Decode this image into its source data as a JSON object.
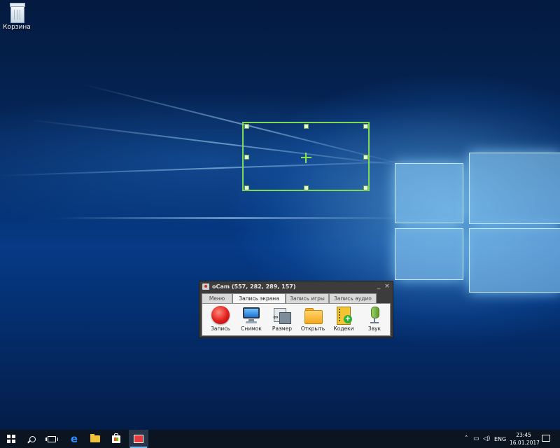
{
  "desktop": {
    "recycle_bin_label": "Корзина",
    "recycle_bin_icon": "recycle-bin-icon"
  },
  "ocam": {
    "title": "oCam (557, 282, 289, 157)",
    "minimize": "_",
    "close": "×",
    "tabs": [
      {
        "label": "Меню",
        "active": false
      },
      {
        "label": "Запись экрана",
        "active": true
      },
      {
        "label": "Запись игры",
        "active": false
      },
      {
        "label": "Запись аудио",
        "active": false
      }
    ],
    "tools": [
      {
        "label": "Запись",
        "icon": "record-icon"
      },
      {
        "label": "Снимок",
        "icon": "monitor-icon"
      },
      {
        "label": "Размер",
        "icon": "resize-icon"
      },
      {
        "label": "Открыть",
        "icon": "folder-icon"
      },
      {
        "label": "Кодеки",
        "icon": "codec-icon"
      },
      {
        "label": "Звук",
        "icon": "microphone-icon"
      }
    ]
  },
  "taskbar": {
    "items": [
      "start",
      "search",
      "task-view",
      "edge",
      "file-explorer",
      "store",
      "ocam"
    ],
    "language": "ENG",
    "time": "23:45",
    "date": "16.01.2017",
    "accent_color": "#76b9ed"
  },
  "capture_region": {
    "border_color": "#7ed957"
  }
}
